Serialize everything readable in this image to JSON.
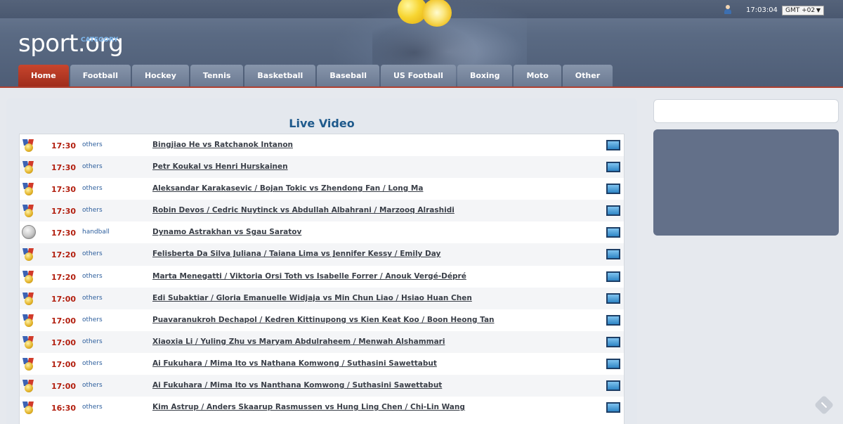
{
  "site": {
    "logo_prefix": "sport",
    "logo_main": "CATEGORY",
    "logo_suffix": ".org"
  },
  "topbar": {
    "clock": "17:03:04",
    "timezone": "GMT +02",
    "timezone_arrow": "▼"
  },
  "nav": {
    "items": [
      {
        "label": "Home",
        "active": true
      },
      {
        "label": "Football"
      },
      {
        "label": "Hockey"
      },
      {
        "label": "Tennis"
      },
      {
        "label": "Basketball"
      },
      {
        "label": "Baseball"
      },
      {
        "label": "US Football"
      },
      {
        "label": "Boxing"
      },
      {
        "label": "Moto"
      },
      {
        "label": "Other"
      }
    ]
  },
  "main": {
    "title": "Live Video",
    "rows": [
      {
        "icon": "medal-icon",
        "time": "17:30",
        "category": "others",
        "match": "Bingjiao He vs Ratchanok Intanon"
      },
      {
        "icon": "medal-icon",
        "time": "17:30",
        "category": "others",
        "match": "Petr Koukal vs Henri Hurskainen"
      },
      {
        "icon": "medal-icon",
        "time": "17:30",
        "category": "others",
        "match": "Aleksandar Karakasevic / Bojan Tokic vs Zhendong Fan / Long Ma"
      },
      {
        "icon": "medal-icon",
        "time": "17:30",
        "category": "others",
        "match": "Robin Devos / Cedric Nuytinck vs Abdullah Albahrani / Marzooq Alrashidi"
      },
      {
        "icon": "handball-icon",
        "time": "17:30",
        "category": "handball",
        "match": "Dynamo Astrakhan vs Sgau Saratov"
      },
      {
        "icon": "medal-icon",
        "time": "17:20",
        "category": "others",
        "match": "Felisberta Da Silva Juliana / Taiana Lima vs Jennifer Kessy / Emily Day"
      },
      {
        "icon": "medal-icon",
        "time": "17:20",
        "category": "others",
        "match": "Marta Menegatti / Viktoria Orsi Toth vs Isabelle Forrer / Anouk Vergé-Dépré"
      },
      {
        "icon": "medal-icon",
        "time": "17:00",
        "category": "others",
        "match": "Edi Subaktiar / Gloria Emanuelle Widjaja vs Min Chun Liao / Hsiao Huan Chen"
      },
      {
        "icon": "medal-icon",
        "time": "17:00",
        "category": "others",
        "match": "Puavaranukroh Dechapol / Kedren Kittinupong vs Kien Keat Koo / Boon Heong Tan"
      },
      {
        "icon": "medal-icon",
        "time": "17:00",
        "category": "others",
        "match": "Xiaoxia Li / Yuling Zhu vs Maryam Abdulraheem / Menwah Alshammari"
      },
      {
        "icon": "medal-icon",
        "time": "17:00",
        "category": "others",
        "match": "Ai Fukuhara / Mima Ito vs Nathana Komwong / Suthasini Sawettabut"
      },
      {
        "icon": "medal-icon",
        "time": "17:00",
        "category": "others",
        "match": "Ai Fukuhara / Mima Ito vs Nanthana Komwong / Suthasini Sawettabut"
      },
      {
        "icon": "medal-icon",
        "time": "16:30",
        "category": "others",
        "match": "Kim Astrup / Anders Skaarup Rasmussen vs Hung Ling Chen / Chi-Lin Wang"
      }
    ]
  },
  "colors": {
    "header": "#5a6a83",
    "nav_active": "#b23a24",
    "title": "#1f5a8c",
    "time": "#b21f0f",
    "category": "#2b5d9c",
    "logo_accent": "#7fb8ee",
    "sidebar_box": "#637089"
  }
}
